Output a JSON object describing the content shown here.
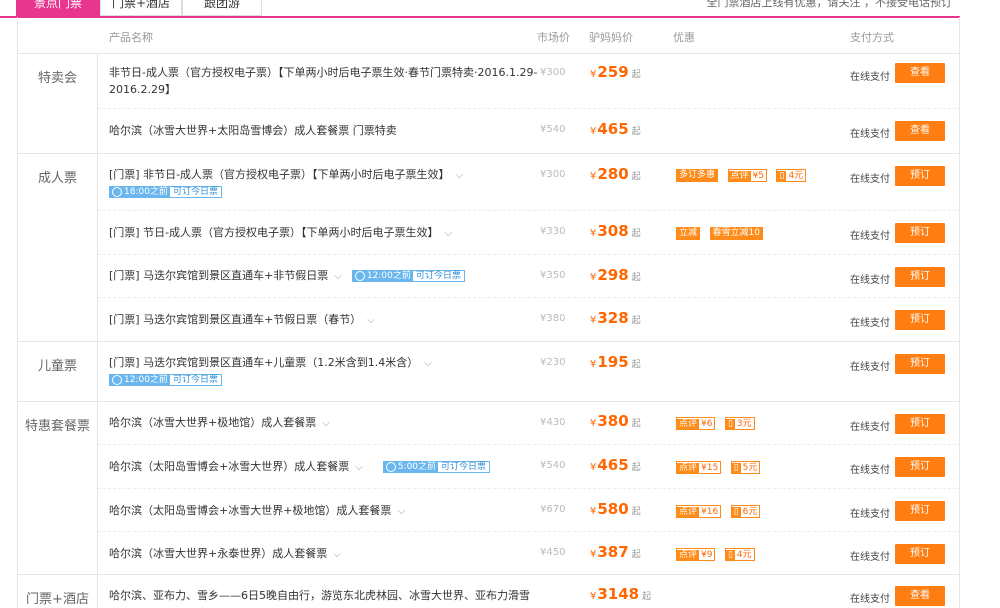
{
  "tabs": [
    {
      "label": "景点门票",
      "active": true
    },
    {
      "label": "门票+酒店",
      "active": false
    },
    {
      "label": "跟团游",
      "active": false
    }
  ],
  "top_right_note": "全门票酒店上线有优惠，请关注   ，不接受电话预订",
  "header": {
    "product": "产品名称",
    "market": "市场价",
    "price": "驴妈妈价",
    "promo": "优惠",
    "pay": "支付方式"
  },
  "common": {
    "yen": "¥",
    "qi": "起",
    "pay_online": "在线支付",
    "chevron": "⌵"
  },
  "groups": [
    {
      "label": "特卖会",
      "rows": [
        {
          "name": "非节日-成人票（官方授权电子票）【下单两小时后电子票生效·春节门票特卖·2016.1.29-2016.2.29】",
          "market": "¥300",
          "price": "259",
          "button": "查看"
        },
        {
          "name": "哈尔滨（冰雪大世界+太阳岛雪博会）成人套餐票 门票特卖",
          "market": "¥540",
          "price": "465",
          "button": "查看"
        }
      ]
    },
    {
      "label": "成人票",
      "rows": [
        {
          "name": "[门票] 非节日-成人票（官方授权电子票）【下单两小时后电子票生效】",
          "time": "18:00之前",
          "date": "可订今日票",
          "market": "¥300",
          "price": "280",
          "promos": [
            {
              "t": "solid",
              "a": "多订多惠"
            },
            {
              "t": "split",
              "a": "点评",
              "b": "¥5"
            },
            {
              "t": "split",
              "a": "▯",
              "b": "4元"
            }
          ],
          "button": "预订"
        },
        {
          "name": "[门票] 节日-成人票（官方授权电子票）【下单两小时后电子票生效】",
          "market": "¥330",
          "price": "308",
          "promos": [
            {
              "t": "solid",
              "a": "立减"
            },
            {
              "t": "solid",
              "a": "春雪立减10"
            }
          ],
          "button": "预订"
        },
        {
          "name": "[门票] 马迭尔宾馆到景区直通车+非节假日票",
          "time": "12:00之前",
          "date": "可订今日票",
          "market": "¥350",
          "price": "298",
          "button": "预订"
        },
        {
          "name": "[门票] 马迭尔宾馆到景区直通车+节假日票（春节）",
          "market": "¥380",
          "price": "328",
          "button": "预订"
        }
      ]
    },
    {
      "label": "儿童票",
      "rows": [
        {
          "name": "[门票] 马迭尔宾馆到景区直通车+儿童票（1.2米含到1.4米含）",
          "time": "12:00之前",
          "date": "可订今日票",
          "market": "¥230",
          "price": "195",
          "button": "预订"
        }
      ]
    },
    {
      "label": "特惠套餐票",
      "rows": [
        {
          "name": "哈尔滨（冰雪大世界+极地馆）成人套餐票",
          "market": "¥430",
          "price": "380",
          "promos": [
            {
              "t": "split",
              "a": "点评",
              "b": "¥6"
            },
            {
              "t": "split",
              "a": "▯",
              "b": "3元"
            }
          ],
          "button": "预订"
        },
        {
          "name": "哈尔滨（太阳岛雪博会+冰雪大世界）成人套餐票",
          "time": "5:00之前",
          "date": "可订今日票",
          "market": "¥540",
          "price": "465",
          "promos": [
            {
              "t": "split",
              "a": "点评",
              "b": "¥15"
            },
            {
              "t": "split",
              "a": "▯",
              "b": "5元"
            }
          ],
          "button": "预订"
        },
        {
          "name": "哈尔滨（太阳岛雪博会+冰雪大世界+极地馆）成人套餐票",
          "market": "¥670",
          "price": "580",
          "promos": [
            {
              "t": "split",
              "a": "点评",
              "b": "¥16"
            },
            {
              "t": "split",
              "a": "▯",
              "b": "6元"
            }
          ],
          "button": "预订"
        },
        {
          "name": "哈尔滨（冰雪大世界+永泰世界）成人套餐票",
          "market": "¥450",
          "price": "387",
          "promos": [
            {
              "t": "split",
              "a": "点评",
              "b": "¥9"
            },
            {
              "t": "split",
              "a": "▯",
              "b": "4元"
            }
          ],
          "button": "预订"
        }
      ]
    },
    {
      "label": "门票+酒店",
      "rows": [
        {
          "name": "哈尔滨、亚布力、雪乡——6日5晚自由行，游览东北虎林园、冰雪大世界、亚布力滑雪",
          "market": "",
          "price": "3148",
          "button": "查看"
        }
      ]
    }
  ]
}
